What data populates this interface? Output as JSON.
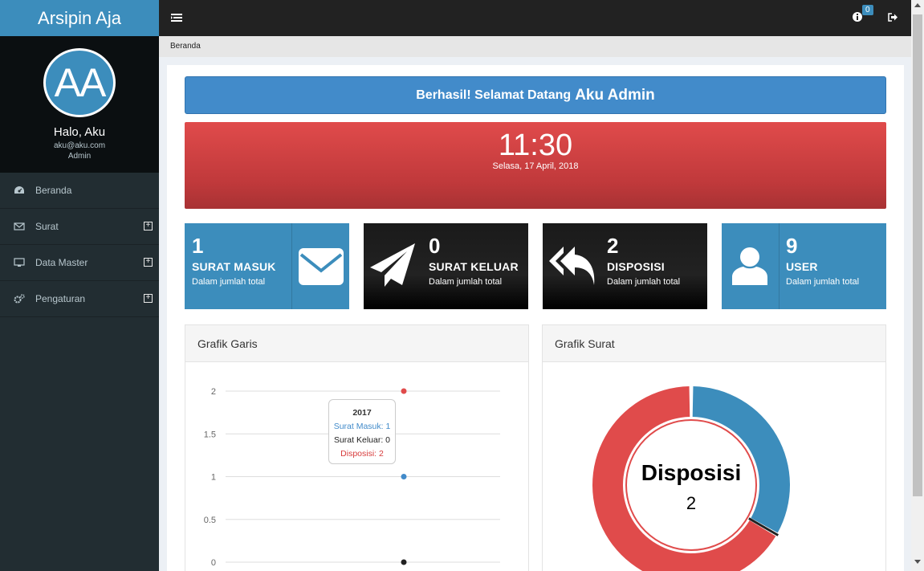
{
  "app": {
    "brand": "Arsipin Aja"
  },
  "profile": {
    "initials": "AA",
    "greeting": "Halo, Aku",
    "email": "aku@aku.com",
    "role": "Admin"
  },
  "sidebar": {
    "items": [
      {
        "label": "Beranda",
        "icon": "dashboard-icon",
        "expandable": false
      },
      {
        "label": "Surat",
        "icon": "envelope-icon",
        "expandable": true
      },
      {
        "label": "Data Master",
        "icon": "desktop-icon",
        "expandable": true
      },
      {
        "label": "Pengaturan",
        "icon": "gears-icon",
        "expandable": true
      }
    ]
  },
  "topbar": {
    "notification_count": "0"
  },
  "breadcrumb": "Beranda",
  "welcome": {
    "prefix": "Berhasil! Selamat Datang",
    "name": "Aku Admin"
  },
  "clock": {
    "time": "11:30",
    "date": "Selasa, 17 April, 2018"
  },
  "stats": [
    {
      "number": "1",
      "label": "SURAT MASUK",
      "sub": "Dalam jumlah total",
      "icon": "envelope-icon",
      "color": "#3c8dbc"
    },
    {
      "number": "0",
      "label": "SURAT KELUAR",
      "sub": "Dalam jumlah total",
      "icon": "paper-plane-icon",
      "color": "#1a1a1a"
    },
    {
      "number": "2",
      "label": "DISPOSISI",
      "sub": "Dalam jumlah total",
      "icon": "reply-all-icon",
      "color": "#1a1a1a"
    },
    {
      "number": "9",
      "label": "USER",
      "sub": "Dalam jumlah total",
      "icon": "user-icon",
      "color": "#3c8dbc"
    }
  ],
  "panels": {
    "line_title": "Grafik Garis",
    "donut_title": "Grafik Surat"
  },
  "tooltip": {
    "year": "2017",
    "lines": [
      "Surat Masuk: 1",
      "Surat Keluar: 0",
      "Disposisi: 2"
    ]
  },
  "chart_data": [
    {
      "type": "line",
      "title": "Grafik Garis",
      "x": [
        "2017"
      ],
      "series": [
        {
          "name": "Surat Masuk",
          "values": [
            1
          ],
          "color": "#428bca"
        },
        {
          "name": "Surat Keluar",
          "values": [
            0
          ],
          "color": "#222222"
        },
        {
          "name": "Disposisi",
          "values": [
            2
          ],
          "color": "#e04b4b"
        }
      ],
      "yticks": [
        "2",
        "1.5",
        "1",
        "0.5",
        "0"
      ],
      "ylim": [
        0,
        2
      ],
      "grid": true
    },
    {
      "type": "pie",
      "title": "Grafik Surat",
      "slices": [
        {
          "name": "Surat Masuk",
          "value": 1,
          "color": "#3c8dbc"
        },
        {
          "name": "Surat Keluar",
          "value": 0,
          "color": "#222222"
        },
        {
          "name": "Disposisi",
          "value": 2,
          "color": "#e04b4b"
        }
      ],
      "center_label": "Disposisi",
      "center_value": "2"
    }
  ]
}
